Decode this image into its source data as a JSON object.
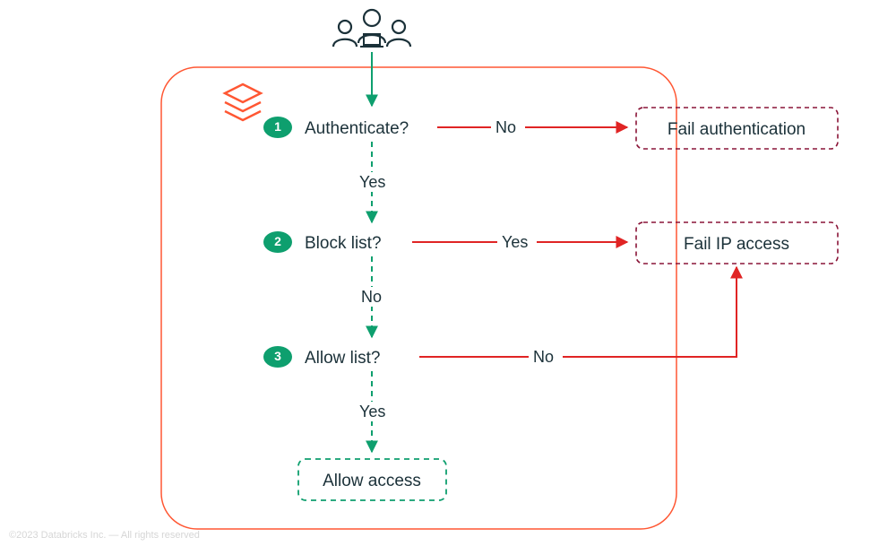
{
  "colors": {
    "green": "#0E9F6E",
    "red": "#E02424",
    "orange": "#FF5733",
    "maroon": "#8A1538",
    "text": "#1B3139"
  },
  "icons": {
    "users": "users-group-icon",
    "databricks": "layers-icon"
  },
  "steps": {
    "s1": {
      "num": "1",
      "label": "Authenticate?"
    },
    "s2": {
      "num": "2",
      "label": "Block list?"
    },
    "s3": {
      "num": "3",
      "label": "Allow list?"
    }
  },
  "edges": {
    "e1no": "No",
    "e1yes": "Yes",
    "e2yes": "Yes",
    "e2no": "No",
    "e3no": "No",
    "e3yes": "Yes"
  },
  "results": {
    "fail_auth": "Fail authentication",
    "fail_ip": "Fail IP access",
    "allow": "Allow access"
  },
  "footer": {
    "copyright": "©2023 Databricks Inc. — All rights reserved"
  }
}
